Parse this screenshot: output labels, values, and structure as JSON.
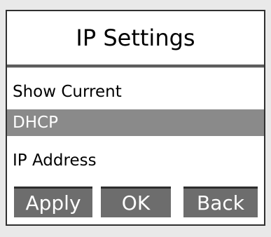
{
  "screen": {
    "title": "IP Settings",
    "menu_items": [
      {
        "label": "Show Current",
        "selected": false
      },
      {
        "label": "DHCP",
        "selected": true
      },
      {
        "label": "IP Address",
        "selected": false
      }
    ],
    "softkeys": {
      "apply": "Apply",
      "ok": "OK",
      "back": "Back"
    }
  },
  "colors": {
    "background": "#e9e9e9",
    "panel": "#ffffff",
    "selected_row": "#8a8a8a",
    "softkey": "#6d6d6d",
    "text": "#000000"
  }
}
